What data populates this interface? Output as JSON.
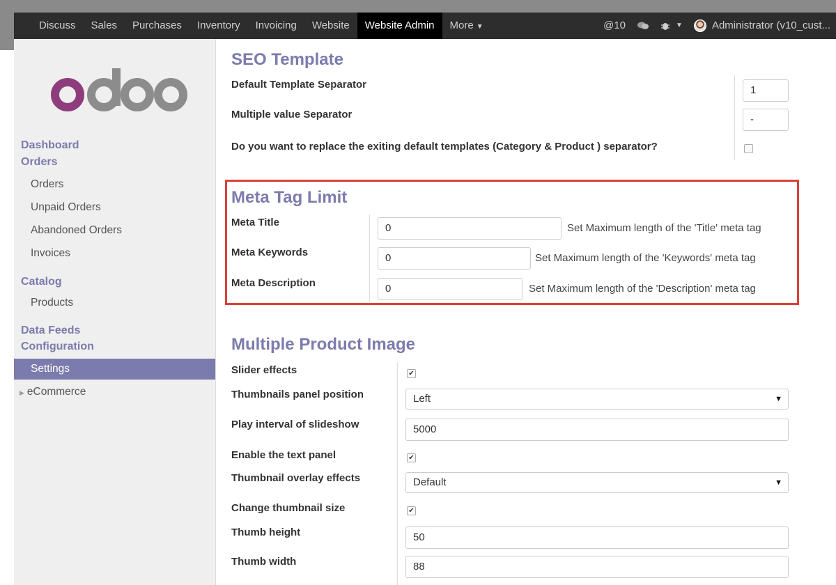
{
  "nav": {
    "items": [
      "Discuss",
      "Sales",
      "Purchases",
      "Inventory",
      "Invoicing",
      "Website",
      "Website Admin",
      "More"
    ],
    "mentions": "@10",
    "user": "Administrator (v10_cust..."
  },
  "sidebar": {
    "heading_dashboard": "Dashboard",
    "heading_orders": "Orders",
    "orders": [
      "Orders",
      "Unpaid Orders",
      "Abandoned Orders",
      "Invoices"
    ],
    "heading_catalog": "Catalog",
    "products": "Products",
    "heading_data_feeds": "Data Feeds",
    "heading_configuration": "Configuration",
    "settings": "Settings",
    "ecommerce": "eCommerce"
  },
  "seo": {
    "title": "SEO Template",
    "default_sep_label": "Default Template Separator",
    "default_sep_value": "1",
    "multi_sep_label": "Multiple value Separator",
    "multi_sep_value": "-",
    "replace_label": "Do you want to replace the exiting default templates (Category & Product ) separator?"
  },
  "meta": {
    "title": "Meta Tag Limit",
    "title_label": "Meta Title",
    "title_value": "0",
    "title_hint": "Set Maximum length of the 'Title' meta tag",
    "keywords_label": "Meta Keywords",
    "keywords_value": "0",
    "keywords_hint": "Set Maximum length of the 'Keywords' meta tag",
    "desc_label": "Meta Description",
    "desc_value": "0",
    "desc_hint": "Set Maximum length of the 'Description' meta tag"
  },
  "mpi": {
    "title": "Multiple Product Image",
    "slider_label": "Slider effects",
    "thumb_pos_label": "Thumbnails panel position",
    "thumb_pos_value": "Left",
    "play_label": "Play interval of slideshow",
    "play_value": "5000",
    "text_panel_label": "Enable the text panel",
    "overlay_label": "Thumbnail overlay effects",
    "overlay_value": "Default",
    "change_size_label": "Change thumbnail size",
    "thumb_h_label": "Thumb height",
    "thumb_h_value": "50",
    "thumb_w_label": "Thumb width",
    "thumb_w_value": "88"
  },
  "colors": {
    "accent": "#7c7bad",
    "highlight": "#d9423b",
    "navbar": "#2d2d2d"
  }
}
